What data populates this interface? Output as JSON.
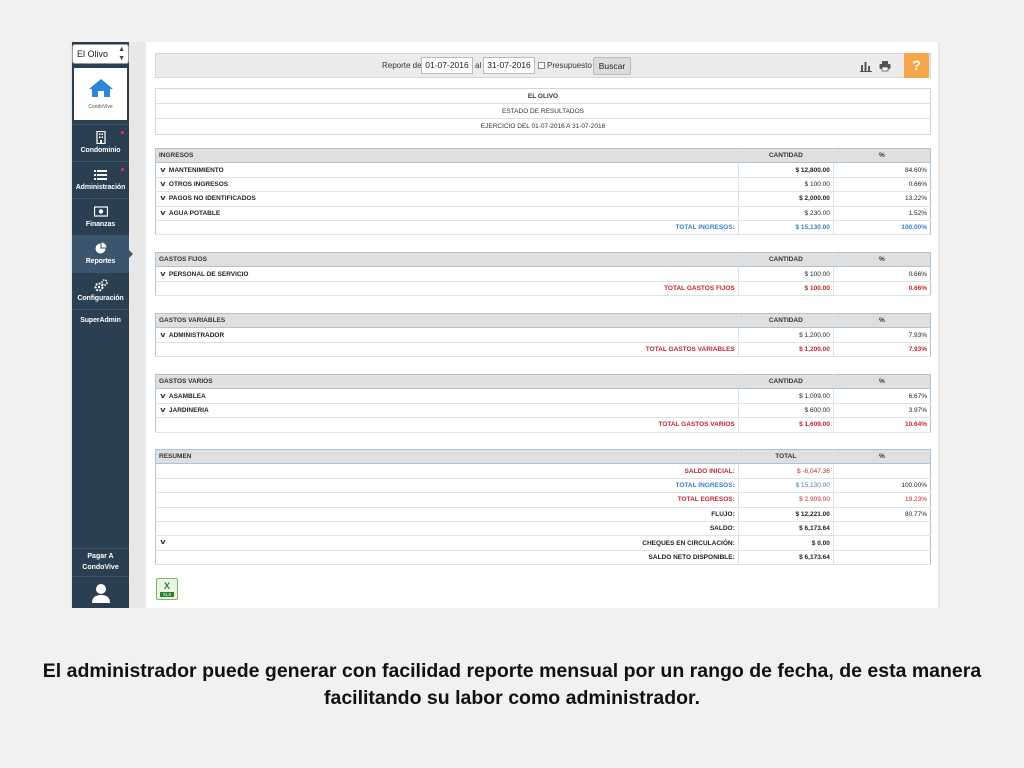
{
  "sidebar": {
    "select_value": "El Olivo",
    "logo_text": "CondoVive",
    "items": [
      {
        "label": "Condominio",
        "icon": "building-icon"
      },
      {
        "label": "Administración",
        "icon": "list-icon"
      },
      {
        "label": "Finanzas",
        "icon": "money-icon"
      },
      {
        "label": "Reportes",
        "icon": "pie-chart-icon"
      },
      {
        "label": "Configuración",
        "icon": "gears-icon"
      },
      {
        "label": "SuperAdmin"
      }
    ],
    "pay_label_1": "Pagar A",
    "pay_label_2": "CondoVive"
  },
  "toolbar": {
    "report_label": "Reporte del",
    "date_from": "01-07-2016",
    "al_label": "al",
    "date_to": "31-07-2016",
    "presupuesto_label": "Presupuesto",
    "search_label": "Buscar",
    "help_label": "?"
  },
  "report_header": {
    "name": "EL OLIVO",
    "subtitle": "ESTADO DE RESULTADOS",
    "period": "EJERCICIO DEL 01-07-2016 A 31-07-2016"
  },
  "ingresos": {
    "title": "INGRESOS",
    "col_amount": "CANTIDAD",
    "col_pct": "%",
    "rows": [
      {
        "label": "MANTENIMIENTO",
        "amount": "$ 12,800.00",
        "pct": "84.60%"
      },
      {
        "label": "OTROS INGRESOS",
        "amount": "$ 100.00",
        "pct": "0.66%"
      },
      {
        "label": "PAGOS NO IDENTIFICADOS",
        "amount": "$ 2,000.00",
        "pct": "13.22%"
      },
      {
        "label": "AGUA POTABLE",
        "amount": "$ 230.00",
        "pct": "1.52%"
      }
    ],
    "total_label": "TOTAL INGRESOS:",
    "total_amount": "$ 15,130.00",
    "total_pct": "100.00%"
  },
  "gastos_fijos": {
    "title": "GASTOS FIJOS",
    "col_amount": "CANTIDAD",
    "col_pct": "%",
    "rows": [
      {
        "label": "PERSONAL DE SERVICIO",
        "amount": "$ 100.00",
        "pct": "0.66%"
      }
    ],
    "total_label": "TOTAL GASTOS FIJOS",
    "total_amount": "$ 100.00",
    "total_pct": "0.66%"
  },
  "gastos_variables": {
    "title": "GASTOS VARIABLES",
    "col_amount": "CANTIDAD",
    "col_pct": "%",
    "rows": [
      {
        "label": "ADMINISTRADOR",
        "amount": "$ 1,200.00",
        "pct": "7.93%"
      }
    ],
    "total_label": "TOTAL GASTOS VARIABLES",
    "total_amount": "$ 1,200.00",
    "total_pct": "7.93%"
  },
  "gastos_varios": {
    "title": "GASTOS VARIOS",
    "col_amount": "CANTIDAD",
    "col_pct": "%",
    "rows": [
      {
        "label": "ASAMBLEA",
        "amount": "$ 1,009.00",
        "pct": "6.67%"
      },
      {
        "label": "JARDINERIA",
        "amount": "$ 600.00",
        "pct": "3.97%"
      }
    ],
    "total_label": "TOTAL GASTOS VARIOS",
    "total_amount": "$ 1,609.00",
    "total_pct": "10.64%"
  },
  "resumen": {
    "title": "RESUMEN",
    "col_amount": "TOTAL",
    "col_pct": "%",
    "saldo_inicial_label": "SALDO INICIAL:",
    "saldo_inicial": "$ -6,047.36",
    "total_ingresos_label": "TOTAL INGRESOS:",
    "total_ingresos": "$ 15,130.00",
    "total_ingresos_pct": "100.00%",
    "total_egresos_label": "TOTAL EGRESOS:",
    "total_egresos": "$ 2,909.00",
    "total_egresos_pct": "19.23%",
    "flujo_label": "FLUJO:",
    "flujo": "$ 12,221.00",
    "flujo_pct": "80.77%",
    "saldo_label": "SALDO:",
    "saldo": "$ 6,173.64",
    "cheques_label": "CHEQUES EN CIRCULACIÓN:",
    "cheques": "$ 0.00",
    "saldo_neto_label": "SALDO NETO DISPONIBLE:",
    "saldo_neto": "$ 6,173.64"
  },
  "export": {
    "x": "X",
    "xls": "XLS"
  },
  "caption": "El administrador puede generar con facilidad reporte mensual por un rango de fecha, de esta manera facilitando su labor como administrador.",
  "colors": {
    "sidebar": "#2b3f52",
    "accent_orange": "#f5a54a",
    "total_blue": "#3c7ec4",
    "total_red": "#c0262d"
  }
}
